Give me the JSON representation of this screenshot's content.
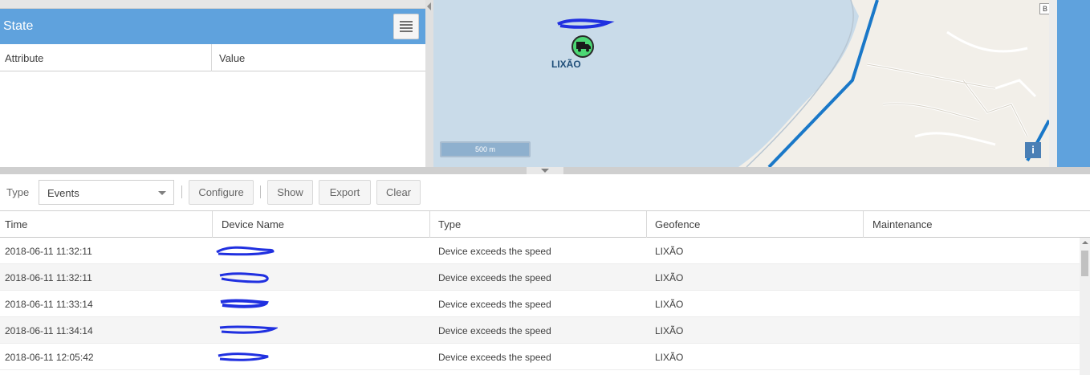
{
  "state_panel": {
    "title": "State",
    "columns": [
      "Attribute",
      "Value"
    ]
  },
  "map": {
    "marker_label": "LIXÃO",
    "scale_label": "500 m",
    "info_label": "i",
    "corner_button_label": "B"
  },
  "toolbar": {
    "type_label": "Type",
    "type_value": "Events",
    "buttons": {
      "configure": "Configure",
      "show": "Show",
      "export": "Export",
      "clear": "Clear"
    }
  },
  "events_grid": {
    "columns": [
      "Time",
      "Device Name",
      "Type",
      "Geofence",
      "Maintenance"
    ],
    "rows": [
      {
        "time": "2018-06-11 11:32:11",
        "type": "Device exceeds the speed",
        "geofence": "LIXÃO",
        "maintenance": ""
      },
      {
        "time": "2018-06-11 11:32:11",
        "type": "Device exceeds the speed",
        "geofence": "LIXÃO",
        "maintenance": ""
      },
      {
        "time": "2018-06-11 11:33:14",
        "type": "Device exceeds the speed",
        "geofence": "LIXÃO",
        "maintenance": ""
      },
      {
        "time": "2018-06-11 11:34:14",
        "type": "Device exceeds the speed",
        "geofence": "LIXÃO",
        "maintenance": ""
      },
      {
        "time": "2018-06-11 12:05:42",
        "type": "Device exceeds the speed",
        "geofence": "LIXÃO",
        "maintenance": ""
      }
    ]
  },
  "colors": {
    "header_blue": "#5fa2dd",
    "marker_green": "#4cd774",
    "route_blue": "#1a78c8",
    "redaction_blue": "#2030e0"
  }
}
